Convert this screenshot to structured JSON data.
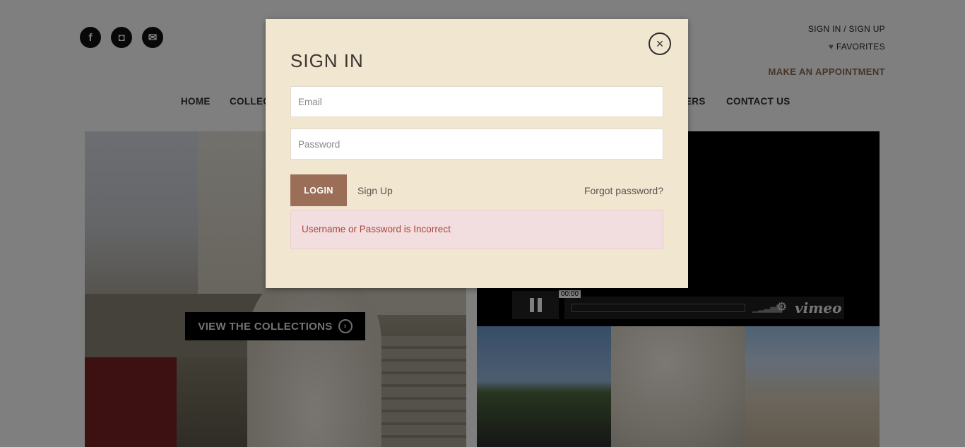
{
  "header": {
    "social": [
      {
        "icon": "facebook-icon",
        "glyph": "f"
      },
      {
        "icon": "instagram-icon",
        "glyph": "◘"
      },
      {
        "icon": "mail-icon",
        "glyph": "✉"
      }
    ],
    "signin_signup": "SIGN IN / SIGN UP",
    "favorites": "FAVORITES",
    "favorites_icon": "heart-icon",
    "appointment": "MAKE AN APPOINTMENT"
  },
  "nav": {
    "home": "HOME",
    "collections_partial": "COLLEC",
    "retailers_partial": "ERS",
    "contact": "CONTACT US"
  },
  "hero": {
    "cta": "VIEW THE COLLECTIONS",
    "cta_icon": "chevron-right-circle-icon"
  },
  "video": {
    "time": "00:00",
    "brand": "vimeo",
    "pause_icon": "pause-icon",
    "volume_icon": "volume-bars-icon",
    "settings_icon": "gear-icon"
  },
  "modal": {
    "title": "SIGN IN",
    "close_glyph": "×",
    "email_placeholder": "Email",
    "password_placeholder": "Password",
    "login_label": "LOGIN",
    "signup_label": "Sign Up",
    "forgot_label": "Forgot password?",
    "error": "Username or Password is Incorrect"
  },
  "colors": {
    "modal_bg": "#f1e6d0",
    "accent": "#9b6f57",
    "error_bg": "#f2dede",
    "error_text": "#a94442"
  }
}
